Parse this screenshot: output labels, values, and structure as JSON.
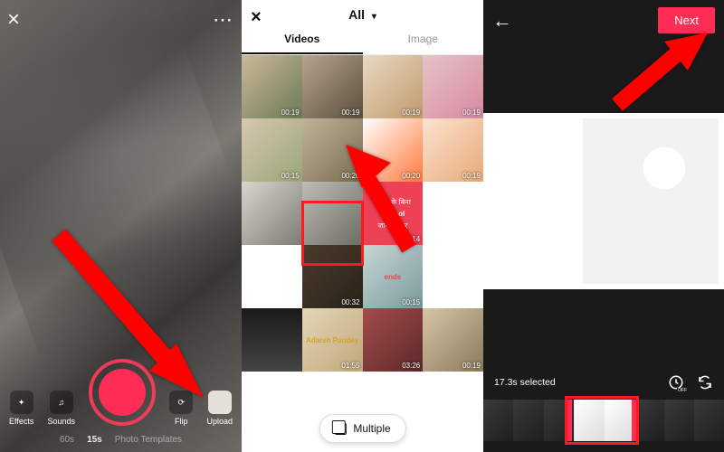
{
  "panel1": {
    "close_label": "×",
    "more_label": "⋯",
    "actions": {
      "effects": "Effects",
      "sounds": "Sounds",
      "flip": "Flip",
      "upload": "Upload"
    },
    "modes": {
      "m60": "60s",
      "m15": "15s",
      "photo_tpl": "Photo Templates"
    }
  },
  "panel2": {
    "close_label": "×",
    "title": "All",
    "tab_videos": "Videos",
    "tab_image": "Image",
    "multiple_label": "Multiple",
    "cells": [
      {
        "dur": "00:19"
      },
      {
        "dur": "00:19"
      },
      {
        "dur": "00:19"
      },
      {
        "dur": "00:19"
      },
      {
        "dur": "00:15"
      },
      {
        "dur": "00:20"
      },
      {
        "dur": "00:20"
      },
      {
        "dur": "00:19"
      },
      {
        "dur": ""
      },
      {
        "dur": ""
      },
      {
        "txt1": "दोस्तों के बिना",
        "txt2": "School",
        "txt3": "जाना बेकार",
        "dur": "00:14"
      },
      {
        "dur": ""
      },
      {
        "dur": ""
      },
      {
        "dur": "00:32"
      },
      {
        "txt1": "ends",
        "dur": "00:15"
      },
      {
        "dur": ""
      },
      {
        "dur": ""
      },
      {
        "txt1": "Adarsh Pandey",
        "dur": "01:55"
      },
      {
        "dur": "03:26"
      },
      {
        "dur": "00:19"
      }
    ]
  },
  "panel3": {
    "next_label": "Next",
    "selected_text": "17.3s selected",
    "speed_off": "OFF"
  }
}
